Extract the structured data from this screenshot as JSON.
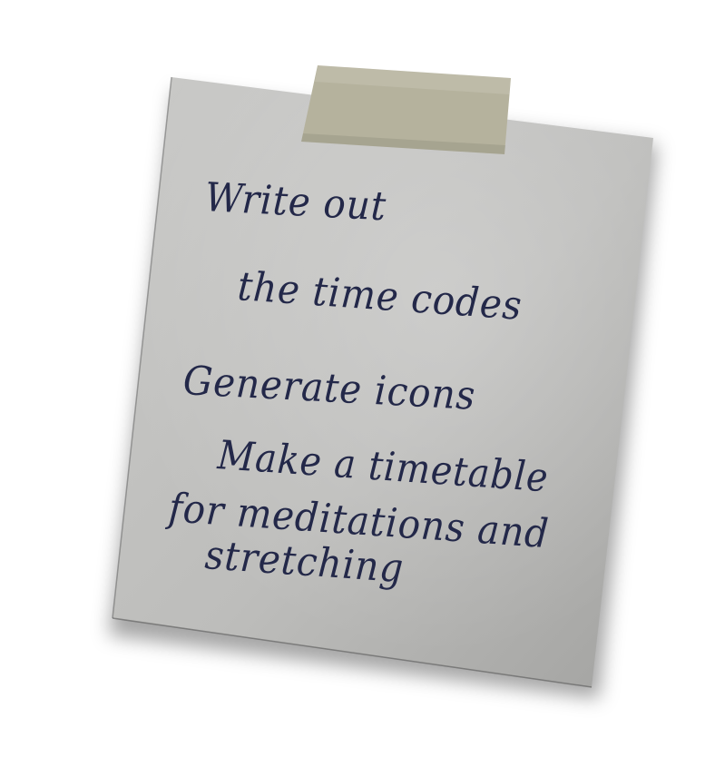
{
  "note": {
    "lines": [
      "Write out",
      "the time codes",
      "Generate icons",
      "Make a timetable",
      "for meditations and",
      "stretching"
    ]
  },
  "colors": {
    "paper": "#bdbdbb",
    "paper_light": "#cfcfcd",
    "paper_dark": "#9e9e9c",
    "ink": "#232849",
    "tape": "#b6b39f"
  }
}
